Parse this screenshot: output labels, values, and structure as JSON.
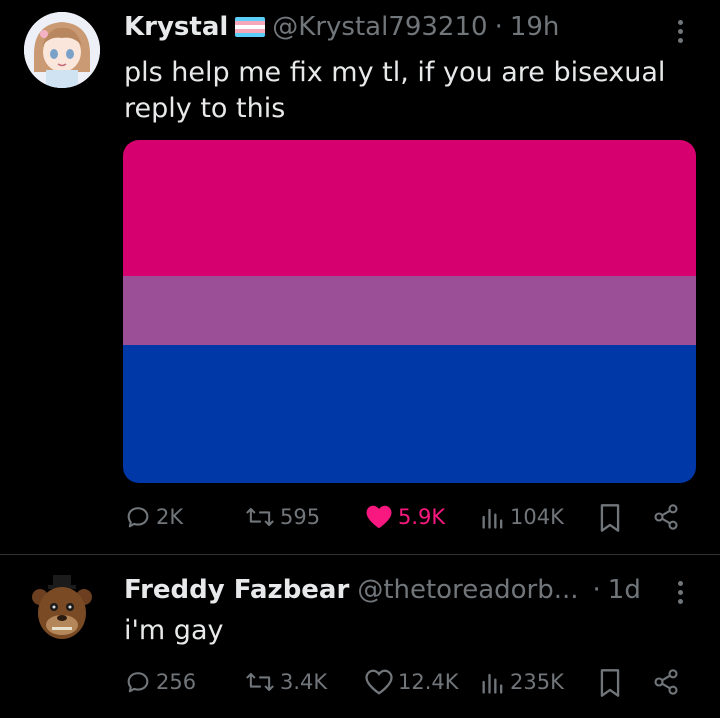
{
  "tweets": [
    {
      "display_name": "Krystal",
      "handle": "@Krystal793210",
      "dot": "·",
      "time": "19h",
      "text_lines": [
        "pls help me fix my tl, if you are bisexual",
        "reply to this"
      ],
      "media": {
        "flag_colors": [
          "#d6006e",
          "#9b4f96",
          "#0038a8"
        ]
      },
      "flag_emoji_colors": [
        "#5bcefa",
        "#f5a9b8",
        "#ffffff",
        "#f5a9b8",
        "#5bcefa"
      ],
      "metrics": {
        "replies": "2K",
        "reposts": "595",
        "likes": "5.9K",
        "views": "104K"
      },
      "liked": true
    },
    {
      "display_name": "Freddy Fazbear",
      "handle": "@thetoreadorb...",
      "dot": "·",
      "time": "1d",
      "text_lines": [
        "i'm gay"
      ],
      "metrics": {
        "replies": "256",
        "reposts": "3.4K",
        "likes": "12.4K",
        "views": "235K"
      },
      "liked": false
    }
  ],
  "colors": {
    "background": "#000000",
    "text": "#e7e9ea",
    "muted": "#71767b",
    "like": "#f91880",
    "divider": "#2f3336"
  }
}
